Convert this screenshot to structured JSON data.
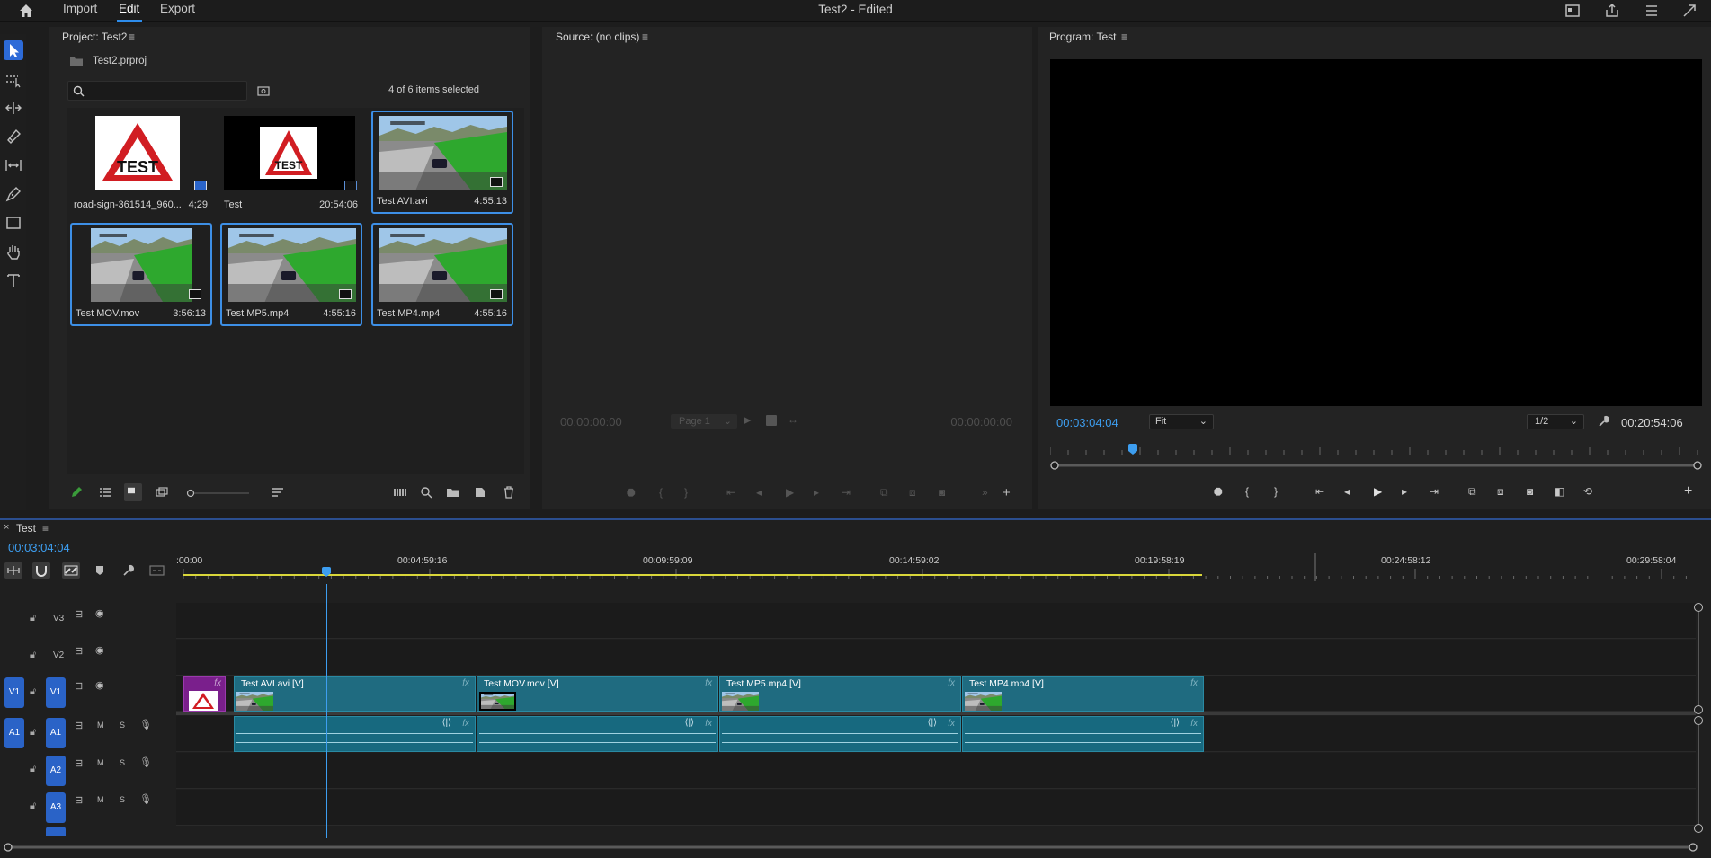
{
  "top_bar": {
    "menu": [
      "Import",
      "Edit",
      "Export"
    ],
    "title": "Test2 - Edited"
  },
  "project": {
    "title": "Project: Test2",
    "file": "Test2.prproj",
    "search_placeholder": "",
    "selection_status": "4 of 6 items selected",
    "items": [
      {
        "name": "road-sign-361514_960...",
        "duration": "4;29"
      },
      {
        "name": "Test",
        "duration": "20:54:06"
      },
      {
        "name": "Test AVI.avi",
        "duration": "4:55:13"
      },
      {
        "name": "Test MOV.mov",
        "duration": "3:56:13"
      },
      {
        "name": "Test MP5.mp4",
        "duration": "4:55:16"
      },
      {
        "name": "Test MP4.mp4",
        "duration": "4:55:16"
      }
    ],
    "thumb_text": "TEST"
  },
  "source": {
    "title": "Source: (no clips)",
    "timecode_in": "00:00:00:00",
    "page": "Page 1",
    "timecode_out": "00:00:00:00"
  },
  "program": {
    "title": "Program: Test",
    "timecode": "00:03:04:04",
    "fit": "Fit",
    "resolution": "1/2",
    "duration": "00:20:54:06"
  },
  "timeline": {
    "sequence_name": "Test",
    "timecode": "00:03:04:04",
    "ruler_labels": [
      ":00:00",
      "00:04:59:16",
      "00:09:59:09",
      "00:14:59:02",
      "00:19:58:19",
      "00:24:58:12",
      "00:29:58:04"
    ],
    "tracks": {
      "v3": "V3",
      "v2": "V2",
      "v1": "V1",
      "v1_src": "V1",
      "a1": "A1",
      "a1_src": "A1",
      "a2": "A2",
      "a3": "A3"
    },
    "track_buttons": {
      "mute": "M",
      "solo": "S"
    },
    "clips": [
      {
        "label": "Test AVI.avi [V]"
      },
      {
        "label": "Test MOV.mov [V]"
      },
      {
        "label": "Test MP5.mp4 [V]"
      },
      {
        "label": "Test MP4.mp4 [V]"
      }
    ],
    "fx_label": "fx"
  },
  "colors": {
    "accent_blue": "#2d8ceb",
    "timecode_blue": "#3d9ef0",
    "clip_teal": "#1f6b80",
    "graphic_purple": "#7a1f8c",
    "work_area_yellow": "#d9d63a"
  }
}
